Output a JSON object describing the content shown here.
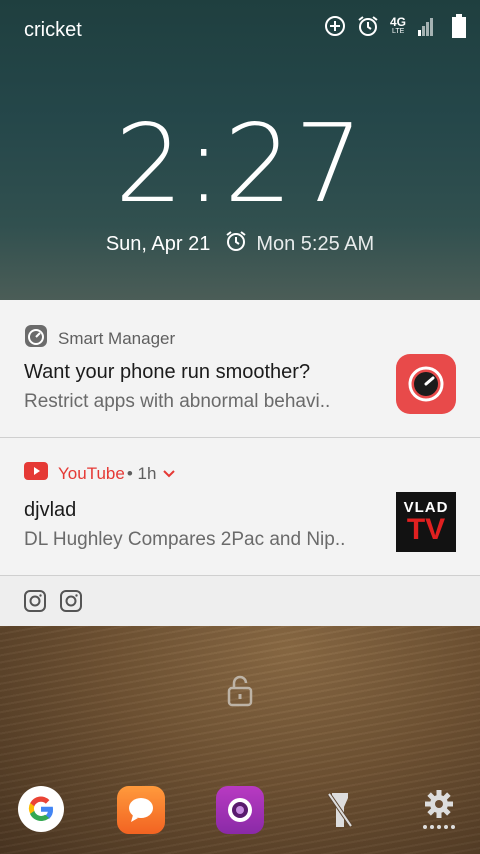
{
  "status_bar": {
    "carrier": "cricket",
    "network": "4G",
    "network_sub": "LTE",
    "icons": [
      "data-saver-icon",
      "alarm-icon",
      "signal-icon",
      "battery-icon"
    ]
  },
  "lockscreen": {
    "time": "2:27",
    "date": "Sun, Apr 21",
    "next_alarm": "Mon 5:25 AM"
  },
  "notifications": [
    {
      "app": "Smart Manager",
      "title": "Want your phone run smoother?",
      "body": "Restrict apps with abnormal behavi..",
      "icon": "smart-manager-icon"
    },
    {
      "app": "YouTube",
      "meta": " • 1h",
      "title": "djvlad",
      "body": "DL Hughley Compares 2Pac and Nip..",
      "thumb_top": "VLAD",
      "thumb_bottom": "TV",
      "icon": "youtube-icon"
    }
  ],
  "overflow_icons": [
    "instagram-icon",
    "instagram-icon"
  ],
  "dock": [
    "google-icon",
    "messages-icon",
    "camera-icon",
    "flashlight-icon",
    "settings-icon"
  ],
  "colors": {
    "youtube_red": "#e53935",
    "smart_manager_red": "#e84a4a"
  }
}
